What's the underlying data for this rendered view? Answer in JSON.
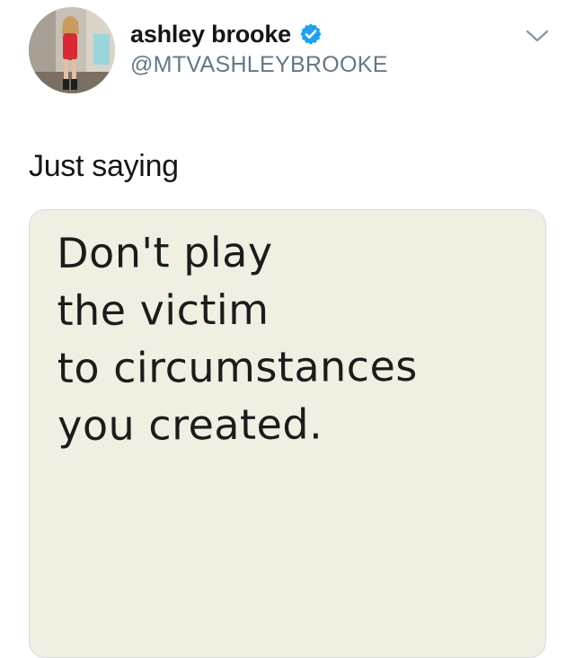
{
  "author": {
    "display_name": "ashley brooke",
    "handle": "@MTVASHLEYBROOKE",
    "verified": true,
    "verified_color": "#1da1f2"
  },
  "tweet": {
    "text": "Just saying"
  },
  "media": {
    "quote_lines": [
      "Don't play",
      "the victim",
      "to circumstances",
      "you created."
    ],
    "background_color": "#f1efe2"
  },
  "icons": {
    "verified": "verified-badge-icon",
    "menu": "chevron-down-icon"
  }
}
